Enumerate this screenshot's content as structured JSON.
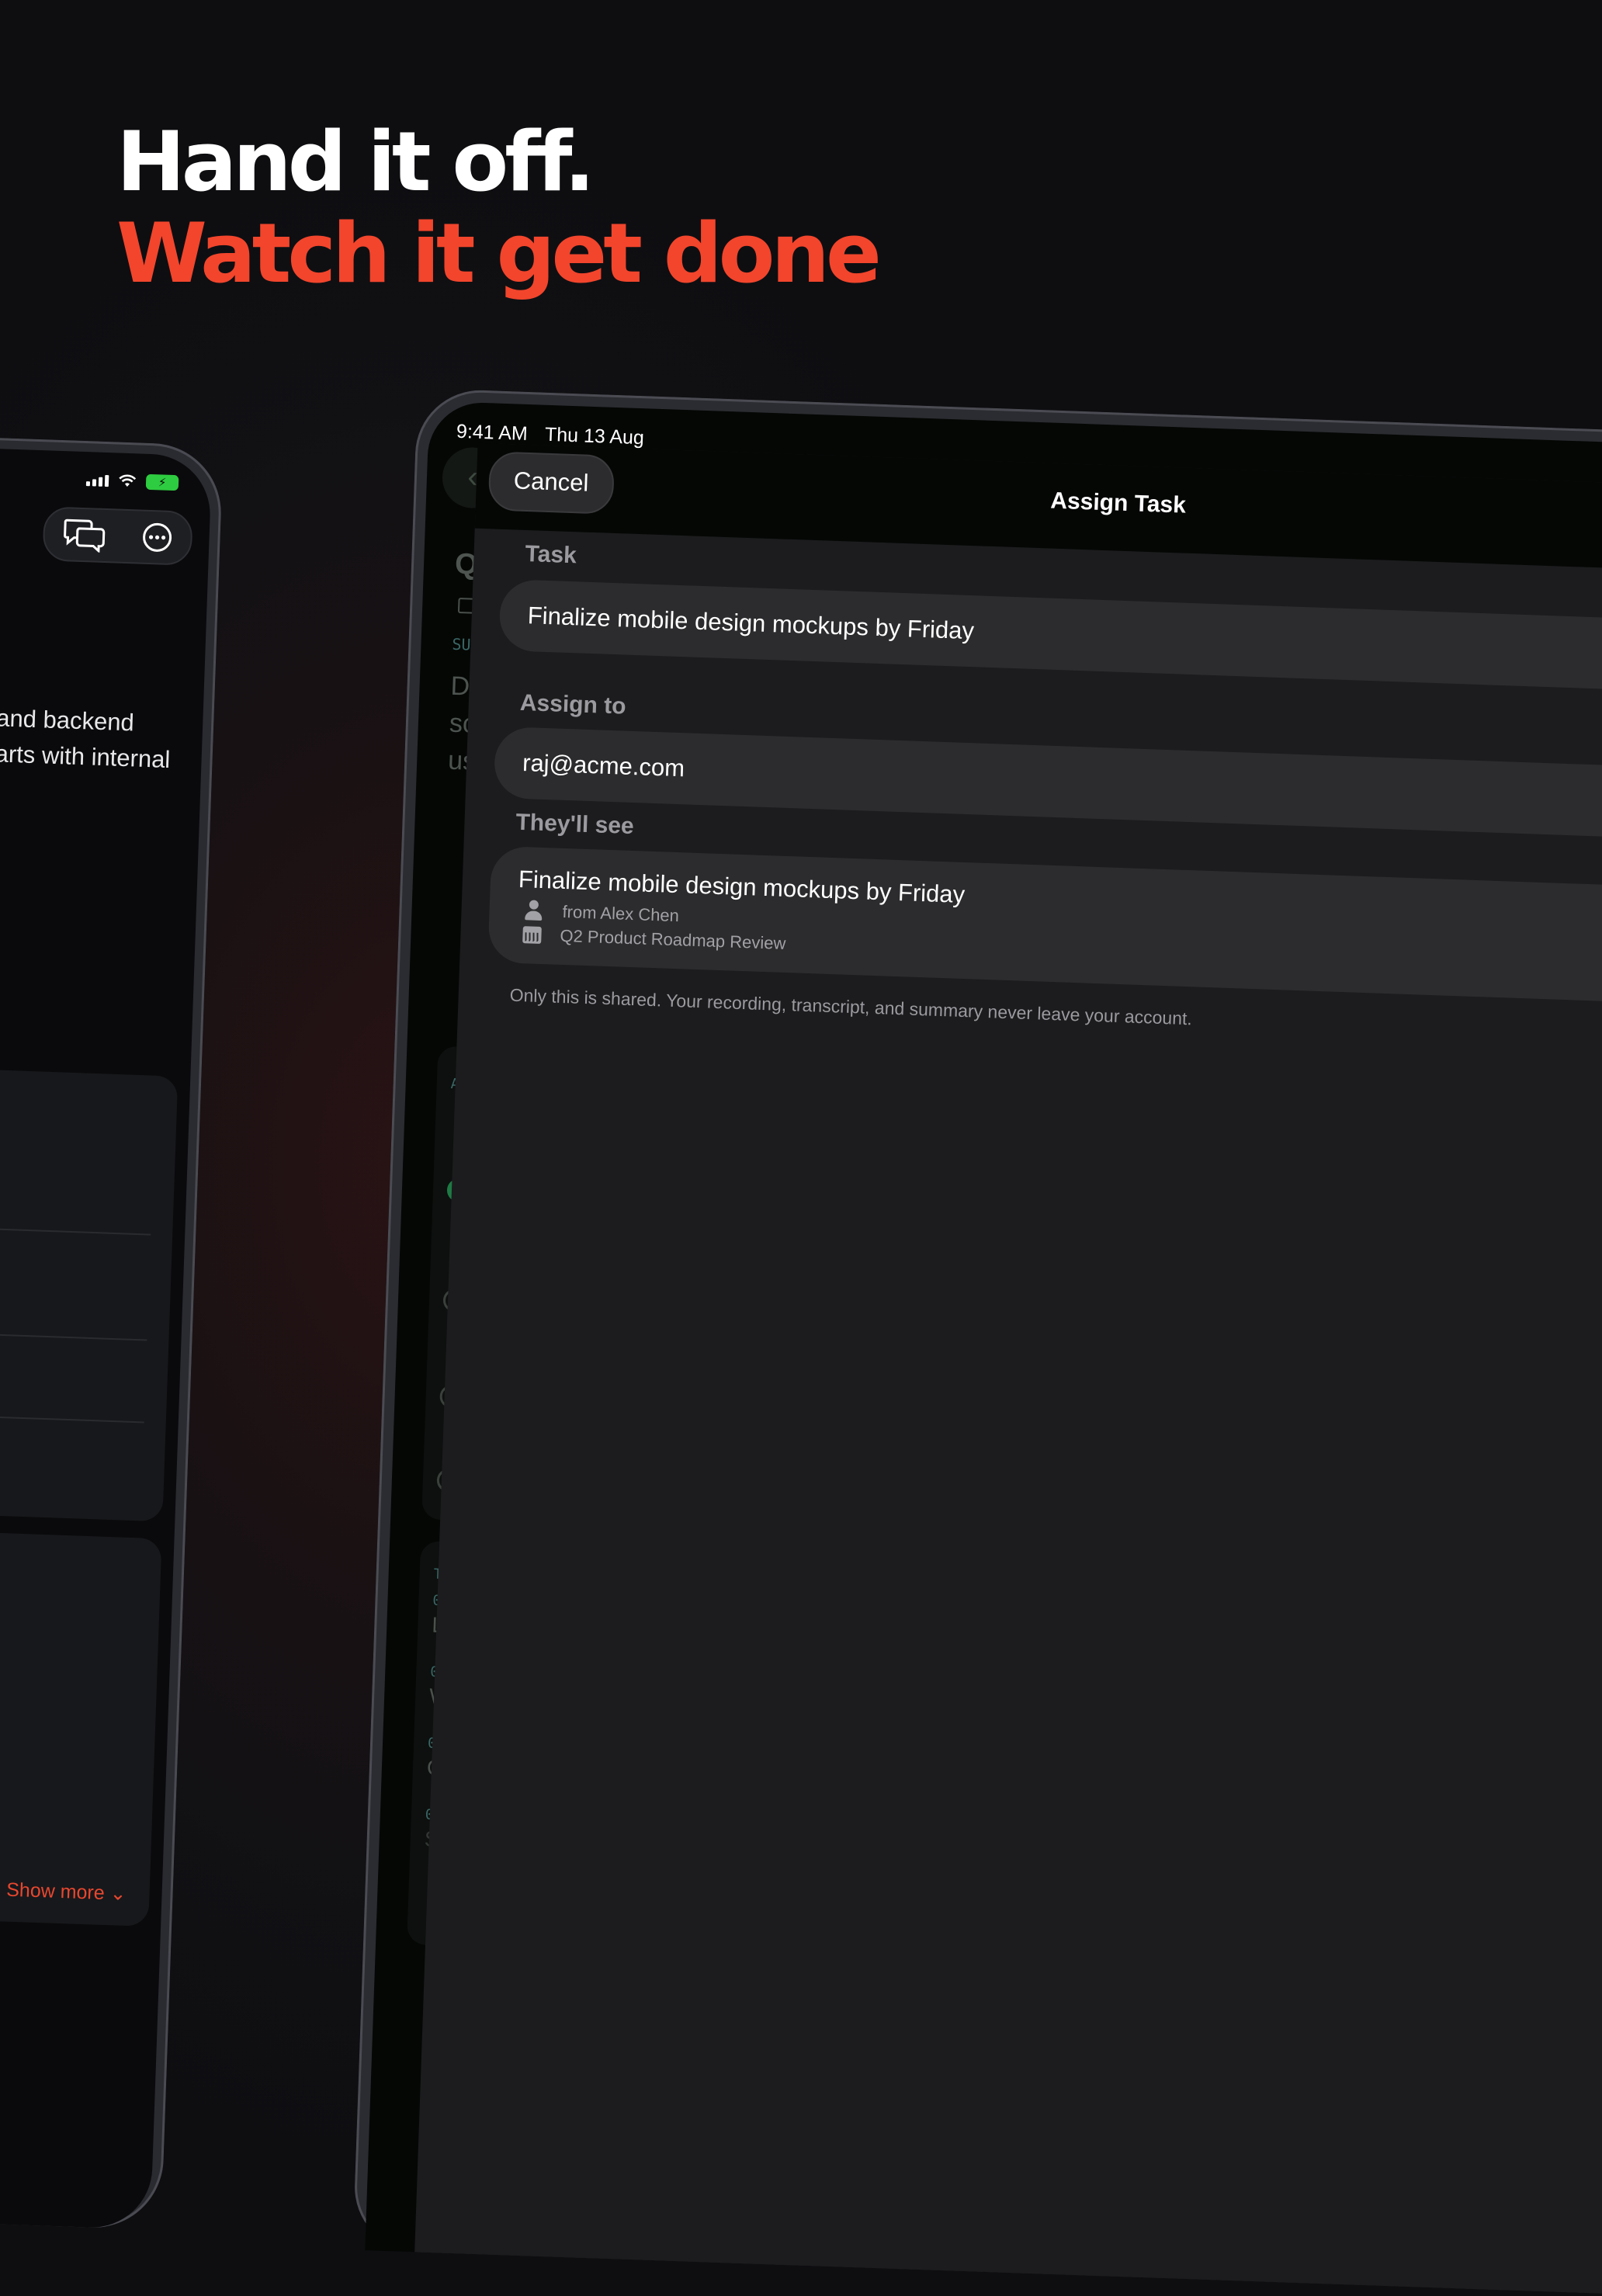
{
  "headline": {
    "line1": "Hand it off.",
    "line2": "Watch it get done"
  },
  "phone": {
    "body_text_line1": "and backend",
    "body_text_line2": "arts with internal",
    "show_more": "Show more",
    "show_more_chevron": "⌄",
    "battery_symbol": "⚡"
  },
  "tablet": {
    "status": {
      "time": "9:41 AM",
      "date": "Thu 13 Aug"
    },
    "background": {
      "back_chevron": "‹",
      "title_fragment": "Q2",
      "summary_label_fragment": "SUM",
      "desc_lines": [
        "Dis",
        "sca",
        "use"
      ],
      "card_label_fragment": "A",
      "transcript_label_fragment": "T",
      "transcript_lines": [
        {
          "time": "0(",
          "text": "L"
        },
        {
          "time": "0(",
          "text": "W"
        },
        {
          "time": "0(",
          "text": "G"
        },
        {
          "time": "0(",
          "text": "S"
        }
      ]
    },
    "sheet": {
      "cancel_label": "Cancel",
      "title": "Assign Task",
      "task_label": "Task",
      "task_value": "Finalize mobile design mockups by Friday",
      "assign_label": "Assign to",
      "assign_value": "raj@acme.com",
      "preview_label": "They'll see",
      "preview_title": "Finalize mobile design mockups by Friday",
      "preview_from": "from Alex Chen",
      "preview_meeting": "Q2 Product Roadmap Review",
      "privacy_note": "Only this is shared. Your recording, transcript, and summary never leave your account."
    }
  },
  "colors": {
    "accent": "#f2452c",
    "success": "#2ecc40"
  }
}
